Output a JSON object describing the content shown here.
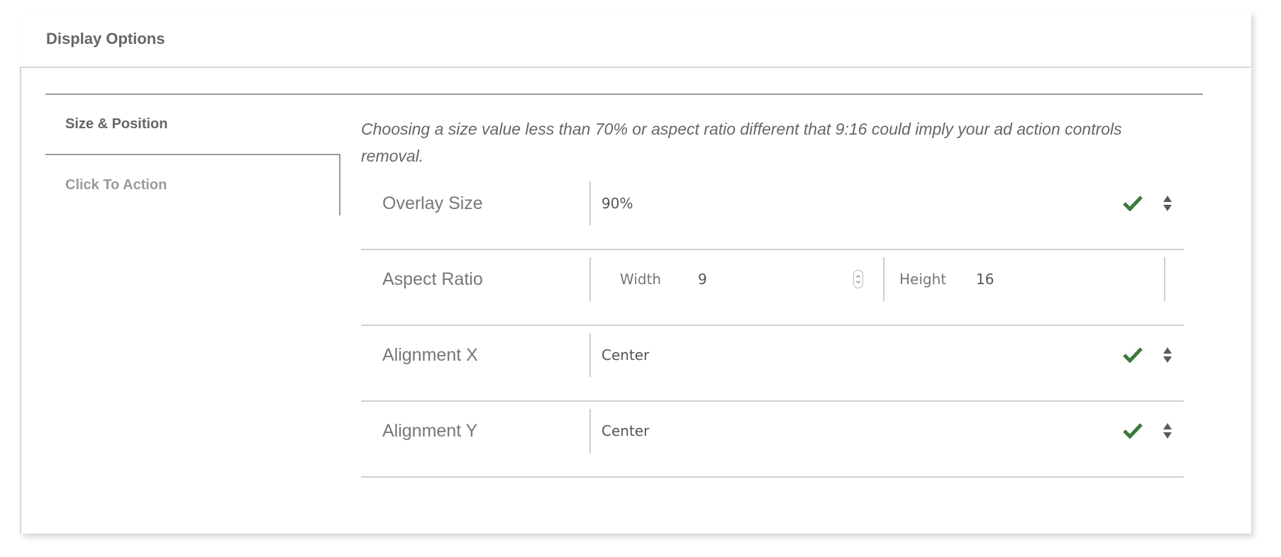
{
  "panel": {
    "title": "Display Options"
  },
  "tabs": [
    {
      "label": "Size & Position",
      "active": true
    },
    {
      "label": "Click To Action",
      "active": false
    }
  ],
  "notice": "Choosing a size value less than 70% or aspect ratio different that 9:16 could imply your ad action controls removal.",
  "fields": {
    "overlay_size": {
      "label": "Overlay Size",
      "value": "90%",
      "valid": true
    },
    "aspect_ratio": {
      "label": "Aspect Ratio",
      "width_label": "Width",
      "width_value": "9",
      "height_label": "Height",
      "height_value": "16"
    },
    "alignment_x": {
      "label": "Alignment X",
      "value": "Center",
      "valid": true
    },
    "alignment_y": {
      "label": "Alignment Y",
      "value": "Center",
      "valid": true
    }
  },
  "colors": {
    "valid_check": "#3a7a3c",
    "stepper": "#5a5a5a"
  }
}
